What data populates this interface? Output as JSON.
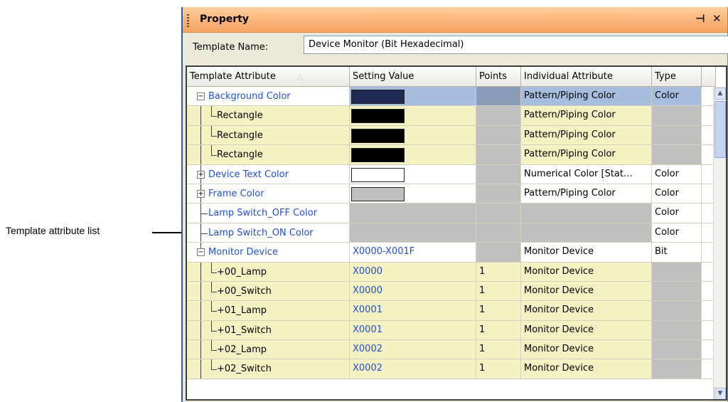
{
  "callout": {
    "label": "Template attribute list"
  },
  "panel": {
    "title": "Property",
    "pin_glyph": "ᵖ",
    "close_glyph": "✕",
    "template_name_label": "Template Name:",
    "template_name_value": "Device Monitor (Bit Hexadecimal)"
  },
  "grid": {
    "columns": [
      "Template Attribute",
      "Setting Value",
      "Points",
      "Individual Attribute",
      "Type"
    ],
    "sort_glyph": "△",
    "rows": [
      {
        "attr": "Background Color",
        "value": "",
        "points": "",
        "individual": "Pattern/Piping Color",
        "type": "Color"
      },
      {
        "attr": "Rectangle",
        "value": "",
        "points": "",
        "individual": "Pattern/Piping Color",
        "type": ""
      },
      {
        "attr": "Rectangle",
        "value": "",
        "points": "",
        "individual": "Pattern/Piping Color",
        "type": ""
      },
      {
        "attr": "Rectangle",
        "value": "",
        "points": "",
        "individual": "Pattern/Piping Color",
        "type": ""
      },
      {
        "attr": "Device Text Color",
        "value": "",
        "points": "",
        "individual": "Numerical Color [Stat…",
        "type": "Color"
      },
      {
        "attr": "Frame Color",
        "value": "",
        "points": "",
        "individual": "Pattern/Piping Color",
        "type": "Color"
      },
      {
        "attr": "Lamp Switch_OFF Color",
        "value": "",
        "points": "",
        "individual": "",
        "type": "Color"
      },
      {
        "attr": "Lamp Switch_ON Color",
        "value": "",
        "points": "",
        "individual": "",
        "type": "Color"
      },
      {
        "attr": "Monitor Device",
        "value": "X0000-X001F",
        "points": "",
        "individual": "Monitor Device",
        "type": "Bit"
      },
      {
        "attr": "+00_Lamp",
        "value": "X0000",
        "points": "1",
        "individual": "Monitor Device",
        "type": ""
      },
      {
        "attr": "+00_Switch",
        "value": "X0000",
        "points": "1",
        "individual": "Monitor Device",
        "type": ""
      },
      {
        "attr": "+01_Lamp",
        "value": "X0001",
        "points": "1",
        "individual": "Monitor Device",
        "type": ""
      },
      {
        "attr": "+01_Switch",
        "value": "X0001",
        "points": "1",
        "individual": "Monitor Device",
        "type": ""
      },
      {
        "attr": "+02_Lamp",
        "value": "X0002",
        "points": "1",
        "individual": "Monitor Device",
        "type": ""
      },
      {
        "attr": "+02_Switch",
        "value": "X0002",
        "points": "1",
        "individual": "Monitor Device",
        "type": ""
      }
    ]
  },
  "colors": {
    "title_bar": "#fbb57a",
    "selected_row": "#a6bde0",
    "child_row": "#f4f1c2",
    "swatch_background": "#1e2a52",
    "swatch_black": "#000000",
    "swatch_white": "#ffffff",
    "swatch_gray": "#c0c0c0",
    "blue_text": "#1f4fd6"
  }
}
